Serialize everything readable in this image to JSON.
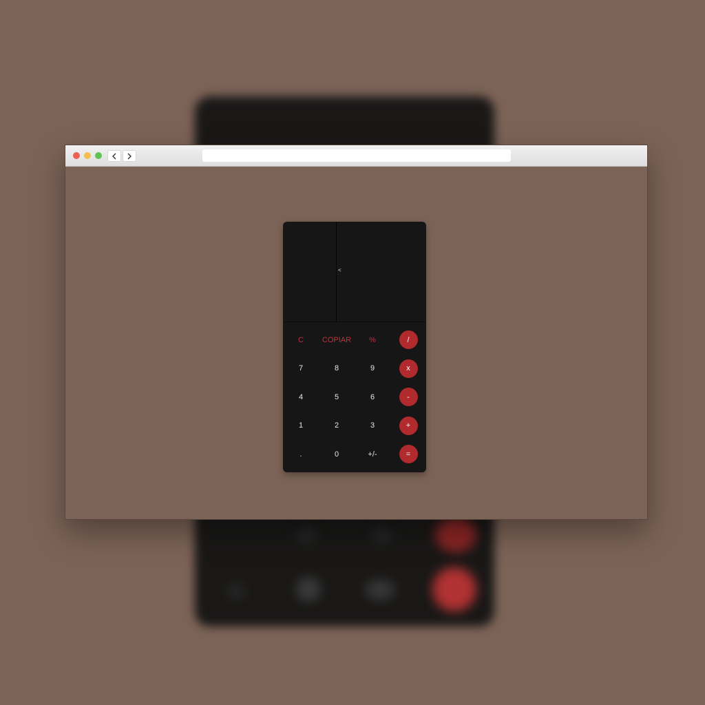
{
  "browser": {
    "url": "",
    "nav": {
      "back_icon": "chevron-left-icon",
      "forward_icon": "chevron-right-icon"
    }
  },
  "calculator": {
    "display": {
      "value": "",
      "backspace_symbol": "<"
    },
    "rows": [
      [
        {
          "label": "C",
          "style": "red-text"
        },
        {
          "label": "COPIAR",
          "style": "red-text"
        },
        {
          "label": "%",
          "style": "red-text"
        },
        {
          "label": "/",
          "style": "circle"
        }
      ],
      [
        {
          "label": "7",
          "style": "plain"
        },
        {
          "label": "8",
          "style": "plain"
        },
        {
          "label": "9",
          "style": "plain"
        },
        {
          "label": "x",
          "style": "circle"
        }
      ],
      [
        {
          "label": "4",
          "style": "plain"
        },
        {
          "label": "5",
          "style": "plain"
        },
        {
          "label": "6",
          "style": "plain"
        },
        {
          "label": "-",
          "style": "circle"
        }
      ],
      [
        {
          "label": "1",
          "style": "plain"
        },
        {
          "label": "2",
          "style": "plain"
        },
        {
          "label": "3",
          "style": "plain"
        },
        {
          "label": "+",
          "style": "circle"
        }
      ],
      [
        {
          "label": ".",
          "style": "plain"
        },
        {
          "label": "0",
          "style": "plain"
        },
        {
          "label": "+/-",
          "style": "plain"
        },
        {
          "label": "=",
          "style": "circle"
        }
      ]
    ]
  },
  "colors": {
    "page_background": "#7c6357",
    "calculator_body": "#161616",
    "accent_red": "#b02a2e",
    "red_text": "#c0323a"
  }
}
